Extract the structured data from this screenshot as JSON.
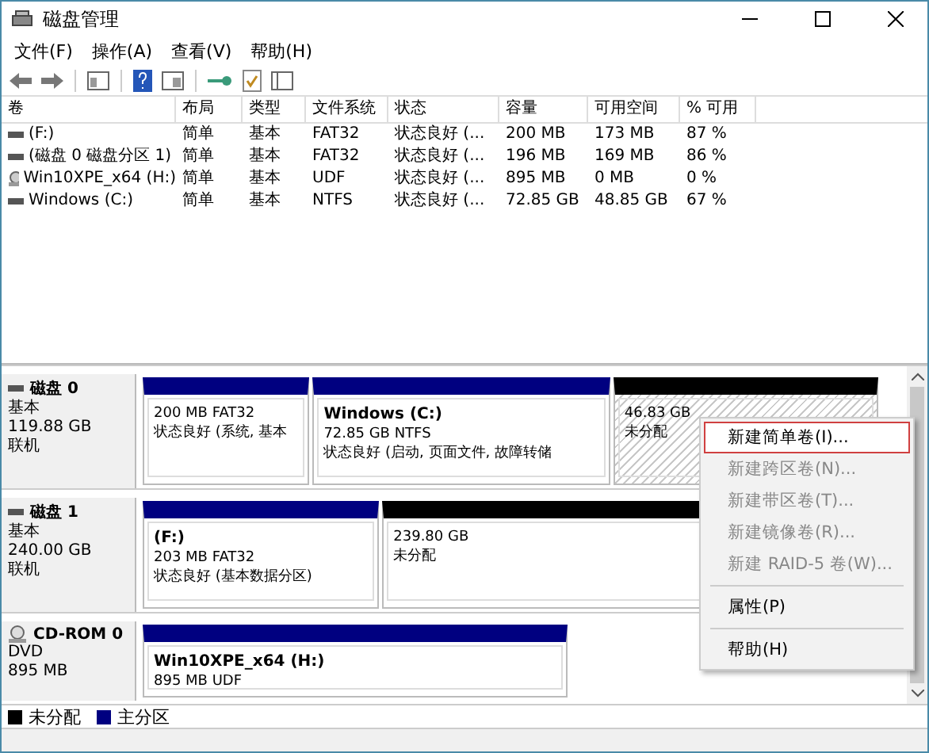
{
  "window": {
    "title": "磁盘管理"
  },
  "menu": [
    {
      "label": "文件(F)"
    },
    {
      "label": "操作(A)"
    },
    {
      "label": "查看(V)"
    },
    {
      "label": "帮助(H)"
    }
  ],
  "table": {
    "columns": [
      "卷",
      "布局",
      "类型",
      "文件系统",
      "状态",
      "容量",
      "可用空间",
      "% 可用"
    ],
    "rows": [
      {
        "kind": "disk",
        "cells": [
          "(F:)",
          "简单",
          "基本",
          "FAT32",
          "状态良好 (...",
          "200 MB",
          "173 MB",
          "87 %"
        ]
      },
      {
        "kind": "disk",
        "cells": [
          "(磁盘 0 磁盘分区 1)",
          "简单",
          "基本",
          "FAT32",
          "状态良好 (...",
          "196 MB",
          "169 MB",
          "86 %"
        ]
      },
      {
        "kind": "cdrom",
        "cells": [
          "Win10XPE_x64 (H:)",
          "简单",
          "基本",
          "UDF",
          "状态良好 (...",
          "895 MB",
          "0 MB",
          "0 %"
        ]
      },
      {
        "kind": "disk",
        "cells": [
          "Windows (C:)",
          "简单",
          "基本",
          "NTFS",
          "状态良好 (...",
          "72.85 GB",
          "48.85 GB",
          "67 %"
        ]
      }
    ]
  },
  "disks": [
    {
      "kind": "disk",
      "name": "磁盘 0",
      "lines": [
        "基本",
        "119.88 GB",
        "联机"
      ],
      "partitions": [
        {
          "kind": "primary",
          "selected": false,
          "lines": [
            "200 MB FAT32",
            "状态良好 (系统, 基本"
          ]
        },
        {
          "kind": "primary",
          "selected": false,
          "title": "Windows  (C:)",
          "lines": [
            "72.85 GB NTFS",
            "状态良好 (启动, 页面文件, 故障转储"
          ]
        },
        {
          "kind": "unallocated",
          "selected": true,
          "lines": [
            "46.83 GB",
            "未分配"
          ]
        }
      ]
    },
    {
      "kind": "disk",
      "name": "磁盘 1",
      "lines": [
        "基本",
        "240.00 GB",
        "联机"
      ],
      "partitions": [
        {
          "kind": "primary",
          "selected": false,
          "title": "(F:)",
          "lines": [
            "203 MB FAT32",
            "状态良好 (基本数据分区)"
          ]
        },
        {
          "kind": "unallocated",
          "selected": false,
          "lines": [
            "239.80 GB",
            "未分配"
          ]
        }
      ]
    },
    {
      "kind": "cdrom",
      "name": "CD-ROM 0",
      "lines": [
        "DVD",
        "895 MB"
      ],
      "partitions": [
        {
          "kind": "primary",
          "selected": false,
          "title": "Win10XPE_x64  (H:)",
          "lines": [
            "895 MB UDF"
          ]
        }
      ]
    }
  ],
  "context_menu": [
    {
      "label": "新建简单卷(I)...",
      "selected": true,
      "disabled": false
    },
    {
      "label": "新建跨区卷(N)...",
      "selected": false,
      "disabled": true
    },
    {
      "label": "新建带区卷(T)...",
      "selected": false,
      "disabled": true
    },
    {
      "label": "新建镜像卷(R)...",
      "selected": false,
      "disabled": true
    },
    {
      "label": "新建 RAID-5 卷(W)...",
      "selected": false,
      "disabled": true,
      "separator_after": true
    },
    {
      "label": "属性(P)",
      "selected": false,
      "disabled": false,
      "separator_after": true
    },
    {
      "label": "帮助(H)",
      "selected": false,
      "disabled": false
    }
  ],
  "legend": [
    {
      "label": "未分配",
      "color": "#000000"
    },
    {
      "label": "主分区",
      "color": "#000080"
    }
  ]
}
